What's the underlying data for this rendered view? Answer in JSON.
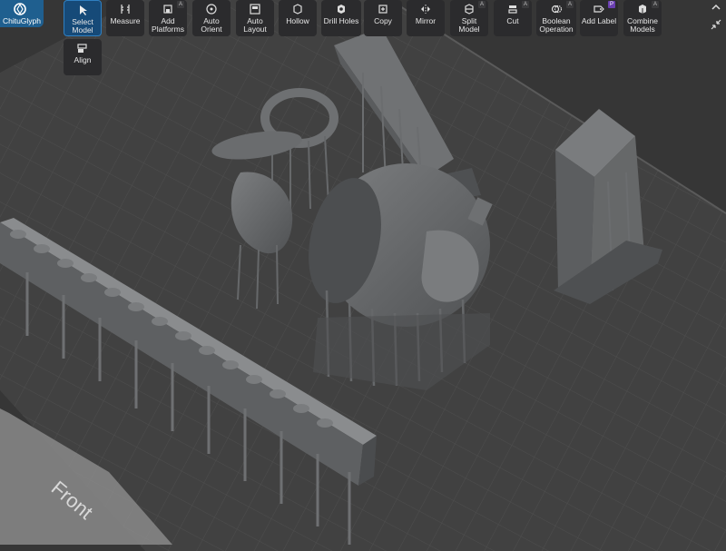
{
  "app": {
    "name": "ChituGlyph"
  },
  "toolbar": {
    "tools": [
      {
        "id": "select-model",
        "label": "Select\nModel",
        "icon": "cursor-icon",
        "active": true
      },
      {
        "id": "measure",
        "label": "Measure",
        "icon": "ruler-icon"
      },
      {
        "id": "add-platforms",
        "label": "Add\nPlatforms",
        "icon": "platform-icon",
        "tag": "A"
      },
      {
        "id": "auto-orient",
        "label": "Auto\nOrient",
        "icon": "orient-icon"
      },
      {
        "id": "auto-layout",
        "label": "Auto\nLayout",
        "icon": "layout-icon"
      },
      {
        "id": "hollow",
        "label": "Hollow",
        "icon": "hollow-icon"
      },
      {
        "id": "drill-holes",
        "label": "Drill Holes",
        "icon": "drill-icon"
      },
      {
        "id": "copy",
        "label": "Copy",
        "icon": "copy-icon"
      },
      {
        "id": "mirror",
        "label": "Mirror",
        "icon": "mirror-icon"
      },
      {
        "id": "split-model",
        "label": "Split\nModel",
        "icon": "split-icon",
        "tag": "A"
      },
      {
        "id": "cut",
        "label": "Cut",
        "icon": "cut-icon",
        "tag": "A"
      },
      {
        "id": "boolean-operation",
        "label": "Boolean\nOperation",
        "icon": "boolean-icon",
        "tag": "A"
      },
      {
        "id": "add-label",
        "label": "Add Label",
        "icon": "label-icon",
        "tag": "P"
      },
      {
        "id": "combine-models",
        "label": "Combine\nModels",
        "icon": "combine-icon",
        "tag": "A"
      }
    ],
    "align_label": "Align"
  },
  "viewport": {
    "front_label": "Front"
  },
  "colors": {
    "accent": "#164a78",
    "background": "#3a3a3a",
    "model": "#6c6e70",
    "grid": "#4d4d4d"
  }
}
